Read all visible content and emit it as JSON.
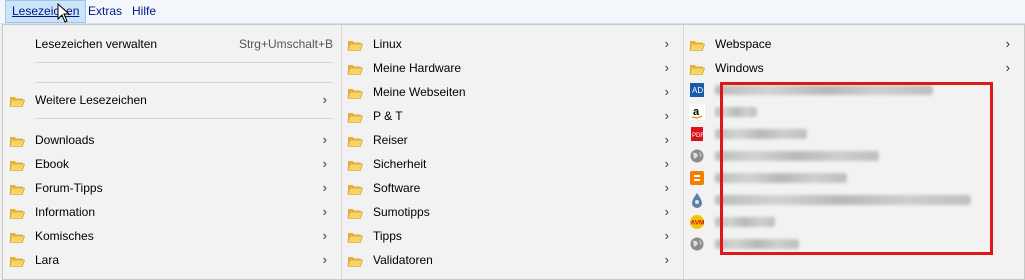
{
  "menubar": {
    "items": [
      {
        "label": "Lesezeichen"
      },
      {
        "label": "Extras"
      },
      {
        "label": "Hilfe"
      }
    ]
  },
  "column1": {
    "manage_label": "Lesezeichen verwalten",
    "manage_shortcut": "Strg+Umschalt+B",
    "more_label": "Weitere Lesezeichen",
    "folders": [
      "Downloads",
      "Ebook",
      "Forum-Tipps",
      "Information",
      "Komisches",
      "Lara"
    ]
  },
  "column2": {
    "folders": [
      "Linux",
      "Meine Hardware",
      "Meine Webseiten",
      "P & T",
      "Reiser",
      "Sicherheit",
      "Software",
      "Sumotipps",
      "Tipps",
      "Validatoren"
    ]
  },
  "column3": {
    "folders": [
      "Webspace",
      "Windows"
    ],
    "bookmarks": [
      {
        "icon": "ad-icon"
      },
      {
        "icon": "amazon-icon"
      },
      {
        "icon": "pdf-icon"
      },
      {
        "icon": "globe-icon"
      },
      {
        "icon": "blogger-icon"
      },
      {
        "icon": "drop-icon"
      },
      {
        "icon": "avm-icon"
      },
      {
        "icon": "globe-icon"
      }
    ]
  },
  "colors": {
    "highlight_box": "#e0161a",
    "folder": "#f5c542",
    "menubar_text": "#001a8c"
  }
}
